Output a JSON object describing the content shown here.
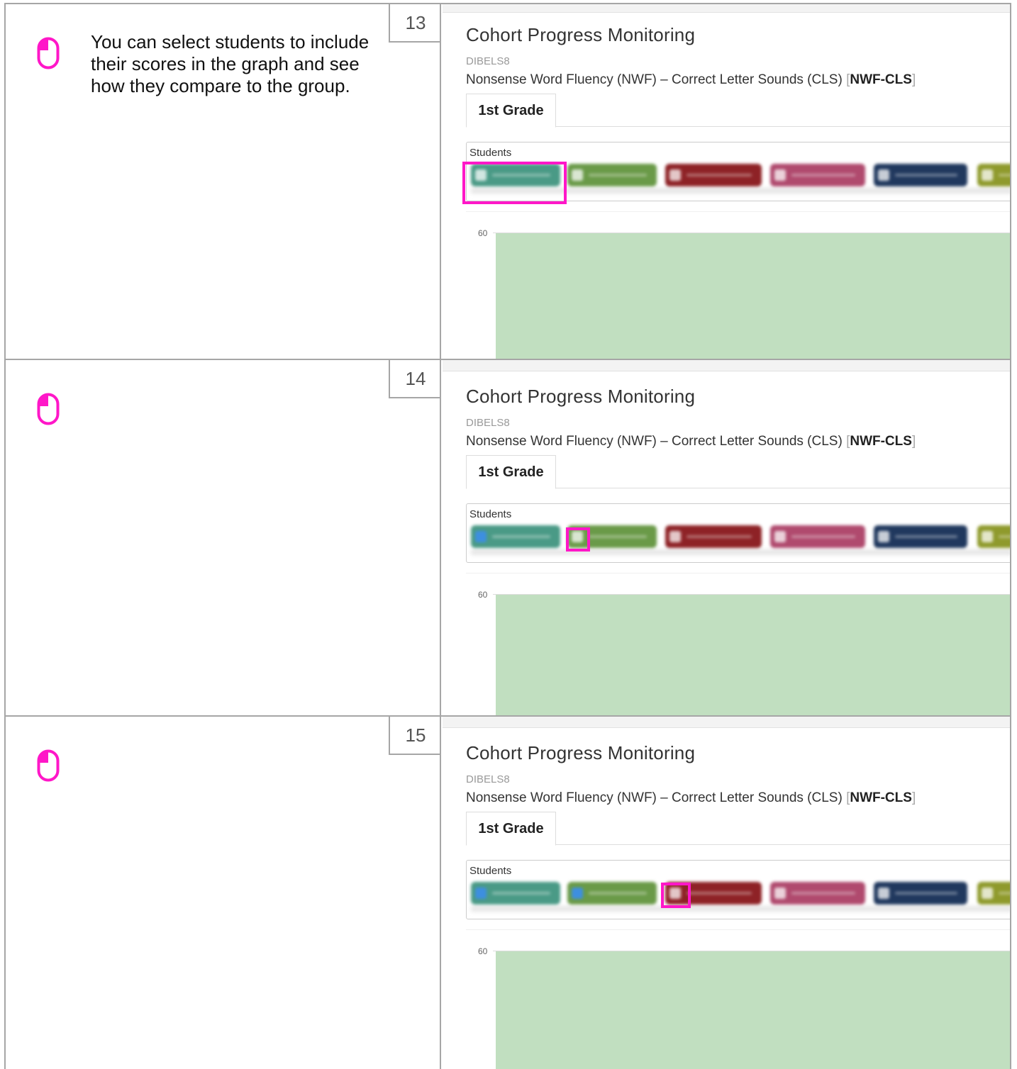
{
  "colors": {
    "accent": "#ff17c8",
    "band": "#c1dfc0"
  },
  "icons": {
    "mouse": "mouse-left-click-icon"
  },
  "screenshot": {
    "title": "Cohort Progress Monitoring",
    "assessment": "DIBELS8",
    "measure_prefix": "Nonsense Word Fluency (NWF) – Correct Letter Sounds (CLS) ",
    "measure_bracket_open": "[",
    "measure_code": "NWF-CLS",
    "measure_bracket_close": "]",
    "tab": "1st Grade",
    "students_label": "Students",
    "y_tick": "60"
  },
  "steps": [
    {
      "number": "13",
      "instruction": "You can select students to include their scores in the graph and see how they compare to the group."
    },
    {
      "number": "14",
      "instruction": ""
    },
    {
      "number": "15",
      "instruction": ""
    }
  ]
}
